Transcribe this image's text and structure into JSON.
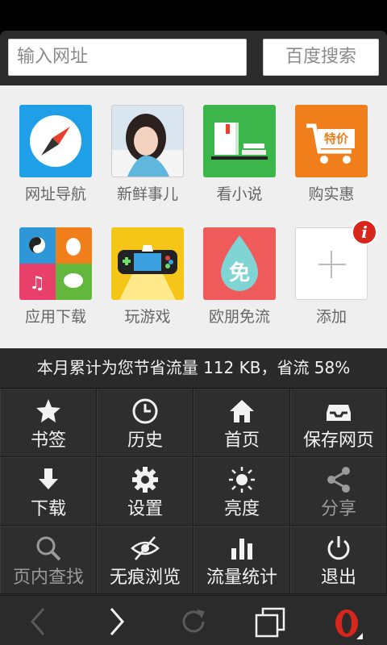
{
  "address_bar": {
    "url_placeholder": "输入网址",
    "search_label": "百度搜索"
  },
  "speed_dial": [
    {
      "label": "网址导航",
      "icon": "compass-icon",
      "color": "#1e9fe8"
    },
    {
      "label": "新鲜事儿",
      "icon": "photo-girl-icon",
      "color": "#dcdcdc"
    },
    {
      "label": "看小说",
      "icon": "books-icon",
      "color": "#3cb54a"
    },
    {
      "label": "购实惠",
      "icon": "cart-icon",
      "color": "#f07e1a"
    },
    {
      "label": "应用下载",
      "icon": "apps-grid-icon",
      "color": "#2d97d8"
    },
    {
      "label": "玩游戏",
      "icon": "gamepad-icon",
      "color": "#f5c518"
    },
    {
      "label": "欧朋免流",
      "icon": "drop-free-icon",
      "color": "#ef5a5a"
    },
    {
      "label": "添加",
      "icon": "plus-icon",
      "color": "#ffffff"
    }
  ],
  "speed_dial_badge": "i",
  "cart_badge": "特价",
  "free_badge": "免",
  "stats_text": "本月累计为您节省流量 112 KB，省流 58%",
  "menu": [
    {
      "label": "书签",
      "icon": "star-icon"
    },
    {
      "label": "历史",
      "icon": "clock-icon"
    },
    {
      "label": "首页",
      "icon": "home-icon"
    },
    {
      "label": "保存网页",
      "icon": "tray-icon"
    },
    {
      "label": "下载",
      "icon": "download-icon"
    },
    {
      "label": "设置",
      "icon": "gear-icon"
    },
    {
      "label": "亮度",
      "icon": "sun-icon"
    },
    {
      "label": "分享",
      "icon": "share-icon"
    },
    {
      "label": "页内查找",
      "icon": "search-icon"
    },
    {
      "label": "无痕浏览",
      "icon": "eye-off-icon"
    },
    {
      "label": "流量统计",
      "icon": "bar-chart-icon"
    },
    {
      "label": "退出",
      "icon": "power-icon"
    }
  ],
  "opera_logo_letter": "O"
}
